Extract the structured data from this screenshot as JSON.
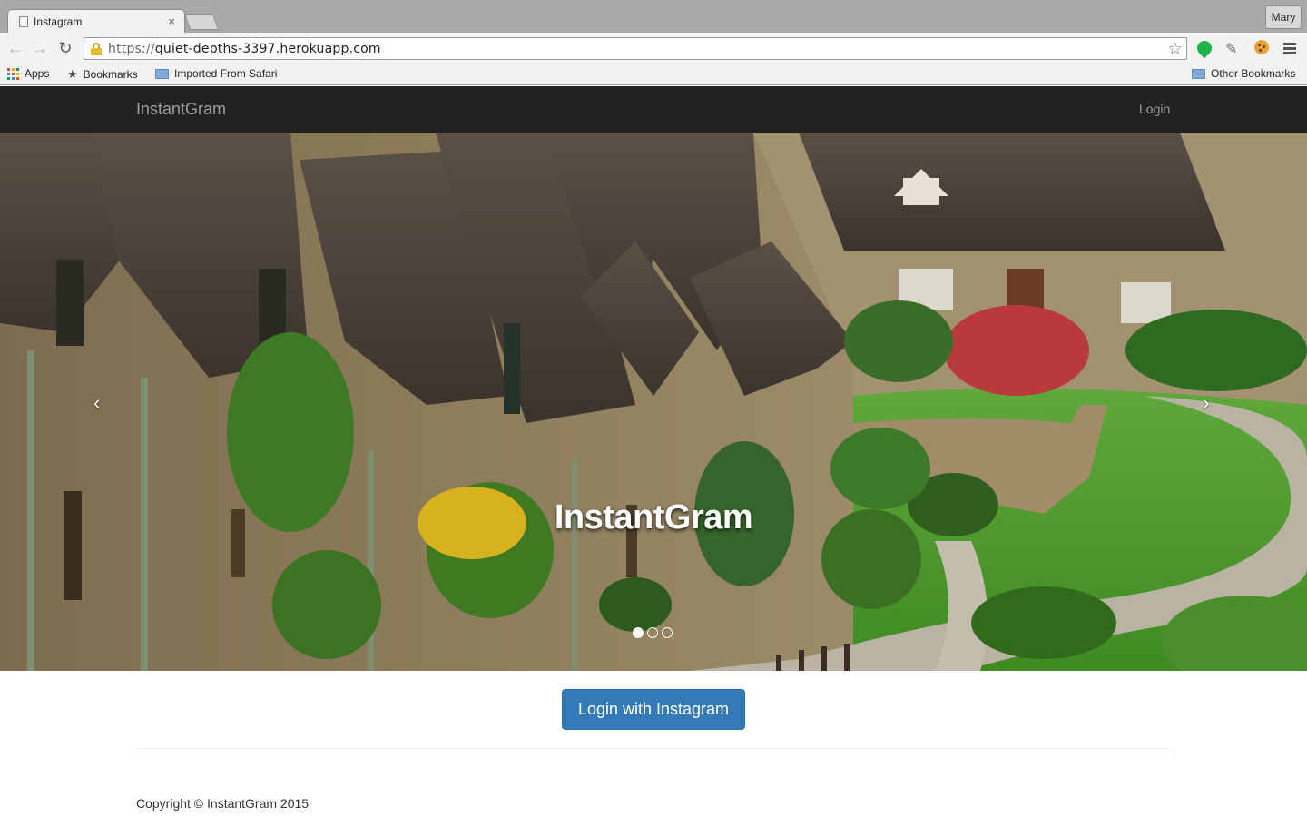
{
  "browser": {
    "tab_title": "Instagram",
    "tab_close": "×",
    "profile_name": "Mary",
    "url_scheme": "https://",
    "url_host": "quiet-depths-3397.herokuapp.com",
    "bookmarks": {
      "apps": "Apps",
      "bookmarks": "Bookmarks",
      "imported": "Imported From Safari",
      "other": "Other Bookmarks"
    }
  },
  "navbar": {
    "brand": "InstantGram",
    "login": "Login"
  },
  "carousel": {
    "caption": "InstantGram",
    "prev": "‹",
    "next": "›",
    "slide_count": 3,
    "active_slide": 1
  },
  "main": {
    "login_button": "Login with Instagram"
  },
  "footer": {
    "copyright": "Copyright © InstantGram 2015"
  },
  "colors": {
    "navbar_bg": "#222222",
    "primary_button": "#337ab7"
  }
}
